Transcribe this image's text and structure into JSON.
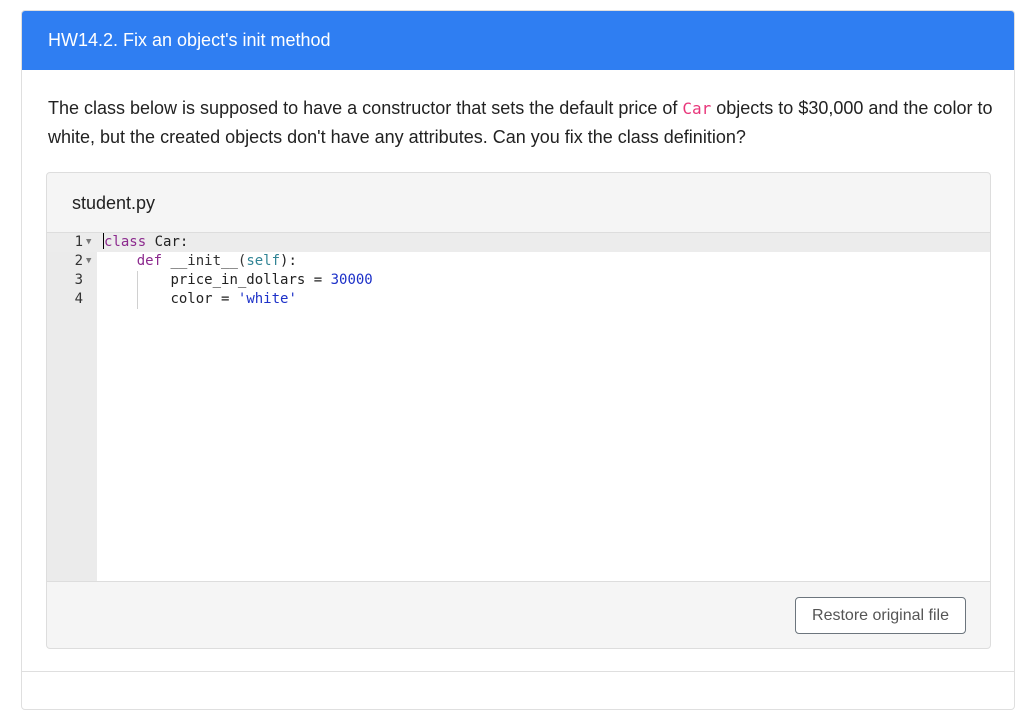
{
  "question": {
    "title": "HW14.2. Fix an object's init method",
    "prompt_before": "The class below is supposed to have a constructor that sets the default price of ",
    "prompt_code": "Car",
    "prompt_after": " objects to $30,000 and the color to white, but the created objects don't have any attributes. Can you fix the class definition?"
  },
  "file": {
    "name": "student.py",
    "lines": [
      {
        "number": "1"
      },
      {
        "number": "2"
      },
      {
        "number": "3"
      },
      {
        "number": "4"
      }
    ],
    "code": {
      "line1_kw": "class",
      "line1_rest": " Car:",
      "line2_indent": "    ",
      "line2_kw": "def",
      "line2_name": " __init__(",
      "line2_param": "self",
      "line2_end": "):",
      "line3_indent": "        ",
      "line3_var": "price_in_dollars",
      "line3_op": " = ",
      "line3_val": "30000",
      "line4_indent": "        ",
      "line4_var": "color",
      "line4_op": " = ",
      "line4_val": "'white'"
    },
    "restore_label": "Restore original file"
  },
  "icons": {
    "fold_line1": "fold-arrow-icon",
    "fold_line2": "fold-arrow-icon"
  }
}
